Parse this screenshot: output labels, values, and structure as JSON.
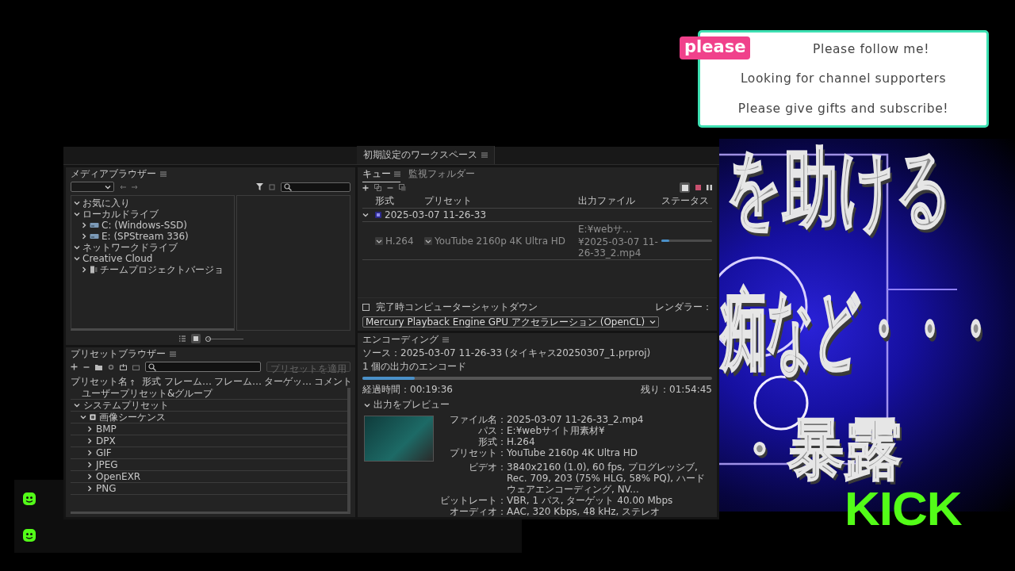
{
  "banner": {
    "tag": "please",
    "lines": [
      "Please follow me!",
      "Looking for channel supporters",
      "Please give gifts and subscribe!"
    ]
  },
  "overlay": {
    "lines": [
      "を助ける",
      "痴など・・・",
      "・暴露"
    ],
    "logo": "KICK"
  },
  "app": {
    "workspace_tab": "初期設定のワークスペース",
    "media_browser": {
      "title": "メディアブラウザー",
      "tree": [
        {
          "label": "お気に入り",
          "expanded": true
        },
        {
          "label": "ローカルドライブ",
          "expanded": true,
          "children": [
            {
              "label": "C: (Windows-SSD)",
              "kind": "drive",
              "expanded": false
            },
            {
              "label": "E: (SPStream 336)",
              "kind": "drive",
              "expanded": false
            }
          ]
        },
        {
          "label": "ネットワークドライブ",
          "expanded": true
        },
        {
          "label": "Creative Cloud",
          "expanded": true,
          "children": [
            {
              "label": "チームプロジェクトバージョ",
              "kind": "project",
              "expanded": false
            }
          ]
        }
      ],
      "view_buttons": [
        {
          "kind": "list",
          "selected": false
        },
        {
          "kind": "thumbnail",
          "selected": true
        }
      ],
      "zoom": {
        "level": 0
      }
    },
    "preset_browser": {
      "title": "プリセットブラウザー",
      "apply_button": {
        "label": "プリセットを適用",
        "disabled": true
      },
      "columns": [
        "プリセット名",
        "形式",
        "フレーム…",
        "フレーム…",
        "ターゲッ…",
        "コメント"
      ],
      "tree": [
        {
          "label": "ユーザープリセット&グループ",
          "kind": "plain"
        },
        {
          "label": "システムプリセット",
          "kind": "folder",
          "expanded": true,
          "children": [
            {
              "label": "画像シーケンス",
              "kind": "category",
              "expanded": true,
              "children": [
                {
                  "label": "BMP",
                  "kind": "folder",
                  "expanded": false
                },
                {
                  "label": "DPX",
                  "kind": "folder",
                  "expanded": false
                },
                {
                  "label": "GIF",
                  "kind": "folder",
                  "expanded": false
                },
                {
                  "label": "JPEG",
                  "kind": "folder",
                  "expanded": false
                },
                {
                  "label": "OpenEXR",
                  "kind": "folder",
                  "expanded": false
                },
                {
                  "label": "PNG",
                  "kind": "folder",
                  "expanded": false
                }
              ]
            }
          ]
        }
      ]
    },
    "queue": {
      "tabs": [
        {
          "label": "キュー",
          "selected": true
        },
        {
          "label": "監視フォルダー",
          "selected": false
        }
      ],
      "columns": [
        "形式",
        "プリセット",
        "出力ファイル",
        "ステータス"
      ],
      "groups": [
        {
          "name": "2025-03-07 11-26-33",
          "expanded": true,
          "items": [
            {
              "format": "H.264",
              "preset": "YouTube 2160p 4K Ultra HD",
              "output": "E:¥webサ…¥2025-03-07 11-26-33_2.mp4",
              "level": 0.15
            }
          ]
        }
      ],
      "shutdown": {
        "label": "完了時コンピューターシャットダウン",
        "checked": false
      },
      "renderer": {
        "label": "レンダラー：",
        "value": "Mercury Playback Engine GPU アクセラレーション (OpenCL)"
      }
    },
    "encoding": {
      "title": "エンコーディング",
      "source": "ソース：2025-03-07 11-26-33 (タイキャス20250307_1.prproj)",
      "outputs": "1 個の出力のエンコード",
      "level": 0.15,
      "elapsed": "経過時間：00:19:36",
      "remaining": "残り：01:54:45",
      "preview_toggle": {
        "label": "出力をプレビュー",
        "expanded": true
      },
      "output_info": [
        {
          "label": "ファイル名：",
          "value": "2025-03-07 11-26-33_2.mp4"
        },
        {
          "label": "パス：",
          "value": "E:¥webサイト用素材¥"
        },
        {
          "label": "形式：",
          "value": "H.264"
        },
        {
          "label": "プリセット：",
          "value": "YouTube 2160p 4K Ultra HD"
        }
      ],
      "settings": [
        {
          "label": "ビデオ：",
          "value": "3840x2160 (1.0), 60 fps, プログレッシブ, Rec. 709, 203 (75% HLG, 58% PQ), ハードウェアエンコーディング, NV..."
        },
        {
          "label": "ビットレート：",
          "value": "VBR, 1 パス, ターゲット 40.00 Mbps"
        },
        {
          "label": "オーディオ：",
          "value": "AAC, 320 Kbps, 48 kHz, ステレオ"
        }
      ]
    }
  }
}
